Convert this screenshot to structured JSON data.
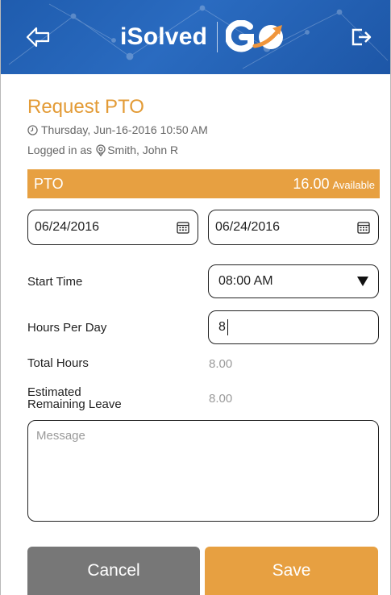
{
  "header": {
    "brand": "iSolved",
    "back_icon": "back-arrow-icon",
    "logout_icon": "logout-icon",
    "go_logo": "go-logo",
    "colors": {
      "header_bg": "#2463b5",
      "go_orange": "#f0953b"
    }
  },
  "request": {
    "title": "Request PTO",
    "datetime": "Thursday, Jun-16-2016 10:50 AM",
    "logged_in_prefix": "Logged in as",
    "user_name": "Smith, John R"
  },
  "pto": {
    "type": "PTO",
    "available_value": "16.00",
    "available_label": "Available",
    "bar_color": "#e7a041"
  },
  "dates": {
    "start": "06/24/2016",
    "end": "06/24/2016"
  },
  "form": {
    "start_time_label": "Start Time",
    "start_time_value": "08:00 AM",
    "hours_per_day_label": "Hours Per Day",
    "hours_per_day_value": "8",
    "total_hours_label": "Total Hours",
    "total_hours_value": "8.00",
    "remaining_label_line1": "Estimated",
    "remaining_label_line2": "Remaining Leave",
    "remaining_value": "8.00",
    "message_placeholder": "Message"
  },
  "actions": {
    "cancel": "Cancel",
    "save": "Save",
    "cancel_color": "#777777",
    "save_color": "#e7a041"
  }
}
